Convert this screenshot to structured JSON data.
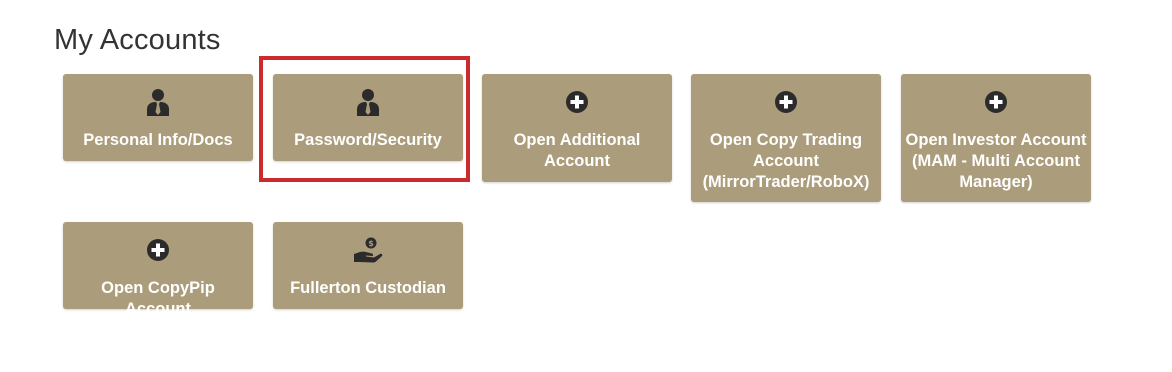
{
  "page": {
    "title": "My Accounts"
  },
  "tiles": [
    {
      "label": "Personal Info/Docs",
      "icon": "user-tie-icon"
    },
    {
      "label": "Password/Security",
      "icon": "user-tie-icon"
    },
    {
      "label": "Open Additional\nAccount",
      "icon": "plus-circle-icon"
    },
    {
      "label": "Open Copy Trading\nAccount\n(MirrorTrader/RoboX)",
      "icon": "plus-circle-icon"
    },
    {
      "label": "Open Investor Account\n(MAM - Multi Account\nManager)",
      "icon": "plus-circle-icon"
    },
    {
      "label": "Open CopyPip Account",
      "icon": "plus-circle-icon"
    },
    {
      "label": "Fullerton Custodian",
      "icon": "hand-coin-icon"
    }
  ],
  "colors": {
    "tile_bg": "#ab9c7b",
    "icon": "#2b2b2b",
    "highlight": "#cc2b2e",
    "title": "#333333"
  }
}
